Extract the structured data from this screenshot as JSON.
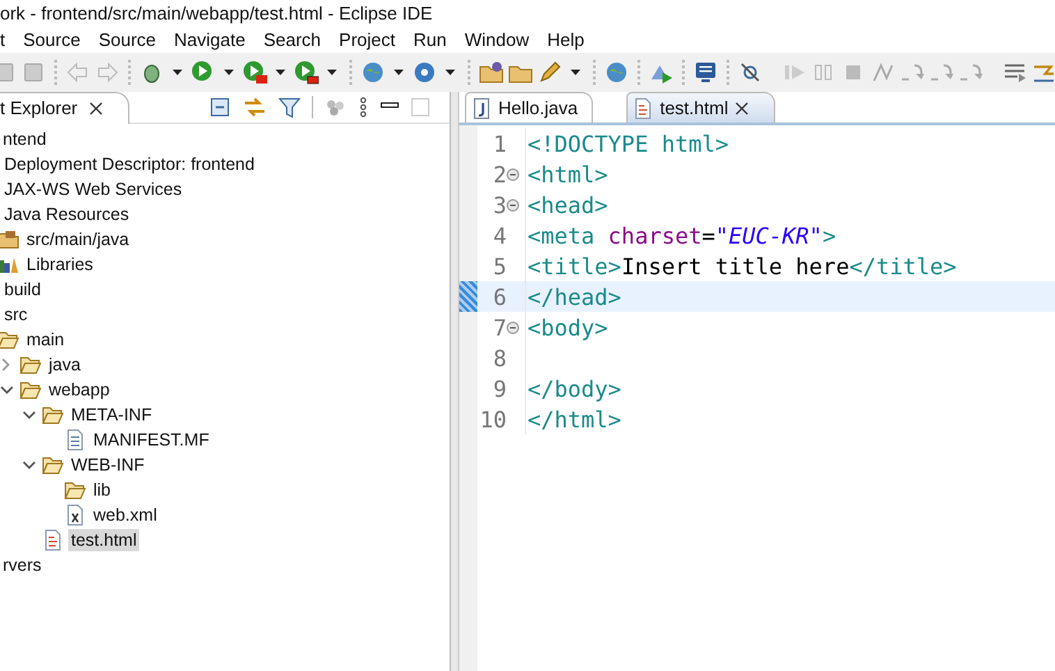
{
  "window": {
    "title": "ork - frontend/src/main/webapp/test.html - Eclipse IDE"
  },
  "menu": [
    {
      "label": "t"
    },
    {
      "label": "Source"
    },
    {
      "label": "Source"
    },
    {
      "label": "Navigate"
    },
    {
      "label": "Search"
    },
    {
      "label": "Project"
    },
    {
      "label": "Run"
    },
    {
      "label": "Window"
    },
    {
      "label": "Help"
    }
  ],
  "explorer": {
    "title": "t Explorer",
    "tree": [
      {
        "label": "ntend",
        "selected": false,
        "children": [
          {
            "label": "Deployment Descriptor: frontend",
            "selected": false
          },
          {
            "label": "JAX-WS Web Services",
            "selected": false
          },
          {
            "label": "Java Resources",
            "selected": false,
            "children": [
              {
                "label": "src/main/java",
                "kind": "package",
                "selected": false
              },
              {
                "label": "Libraries",
                "kind": "library",
                "selected": false
              }
            ]
          },
          {
            "label": "build",
            "selected": false
          },
          {
            "label": "src",
            "selected": false,
            "children": [
              {
                "label": "main",
                "kind": "folder",
                "selected": false,
                "children": [
                  {
                    "label": "java",
                    "kind": "folder",
                    "expanded": false,
                    "selected": false
                  },
                  {
                    "label": "webapp",
                    "kind": "folder",
                    "expanded": true,
                    "selected": false,
                    "children": [
                      {
                        "label": "META-INF",
                        "kind": "folder",
                        "expanded": true,
                        "selected": false,
                        "children": [
                          {
                            "label": "MANIFEST.MF",
                            "kind": "text",
                            "selected": false
                          }
                        ]
                      },
                      {
                        "label": "WEB-INF",
                        "kind": "folder",
                        "expanded": true,
                        "selected": false,
                        "children": [
                          {
                            "label": "lib",
                            "kind": "folder",
                            "selected": false
                          },
                          {
                            "label": "web.xml",
                            "kind": "xml",
                            "selected": false
                          }
                        ]
                      },
                      {
                        "label": "test.html",
                        "kind": "html",
                        "selected": true
                      }
                    ]
                  }
                ]
              }
            ]
          }
        ]
      },
      {
        "label": "rvers",
        "selected": false
      }
    ]
  },
  "editor": {
    "tabs": [
      {
        "label": "Hello.java",
        "kind": "java",
        "selected": false
      },
      {
        "label": "test.html",
        "kind": "html",
        "selected": true
      }
    ],
    "lines": [
      {
        "number": "1",
        "fold": false,
        "current": false,
        "parts": [
          {
            "kind": "tag",
            "text": "<!DOCTYPE html>"
          }
        ]
      },
      {
        "number": "2",
        "fold": true,
        "current": false,
        "parts": [
          {
            "kind": "tag",
            "text": "<html>"
          }
        ]
      },
      {
        "number": "3",
        "fold": true,
        "current": false,
        "parts": [
          {
            "kind": "tag",
            "text": "<head>"
          }
        ]
      },
      {
        "number": "4",
        "fold": false,
        "current": false,
        "parts": [
          {
            "kind": "tag",
            "text": "<meta "
          },
          {
            "kind": "attr",
            "text": "charset"
          },
          {
            "kind": "plain",
            "text": "="
          },
          {
            "kind": "string",
            "text": "\"EUC-KR\""
          },
          {
            "kind": "tag",
            "text": ">"
          }
        ]
      },
      {
        "number": "5",
        "fold": false,
        "current": false,
        "parts": [
          {
            "kind": "tag",
            "text": "<title>"
          },
          {
            "kind": "plain",
            "text": "Insert title here"
          },
          {
            "kind": "tag",
            "text": "</title>"
          }
        ]
      },
      {
        "number": "6",
        "fold": false,
        "current": true,
        "parts": [
          {
            "kind": "tag",
            "text": "</head>"
          }
        ]
      },
      {
        "number": "7",
        "fold": true,
        "current": false,
        "parts": [
          {
            "kind": "tag",
            "text": "<body>"
          }
        ]
      },
      {
        "number": "8",
        "fold": false,
        "current": false
      },
      {
        "number": "9",
        "fold": false,
        "current": false,
        "parts": [
          {
            "kind": "tag",
            "text": "</body>"
          }
        ]
      },
      {
        "number": "10",
        "fold": false,
        "current": false,
        "parts": [
          {
            "kind": "tag",
            "text": "</html>"
          }
        ]
      }
    ]
  }
}
